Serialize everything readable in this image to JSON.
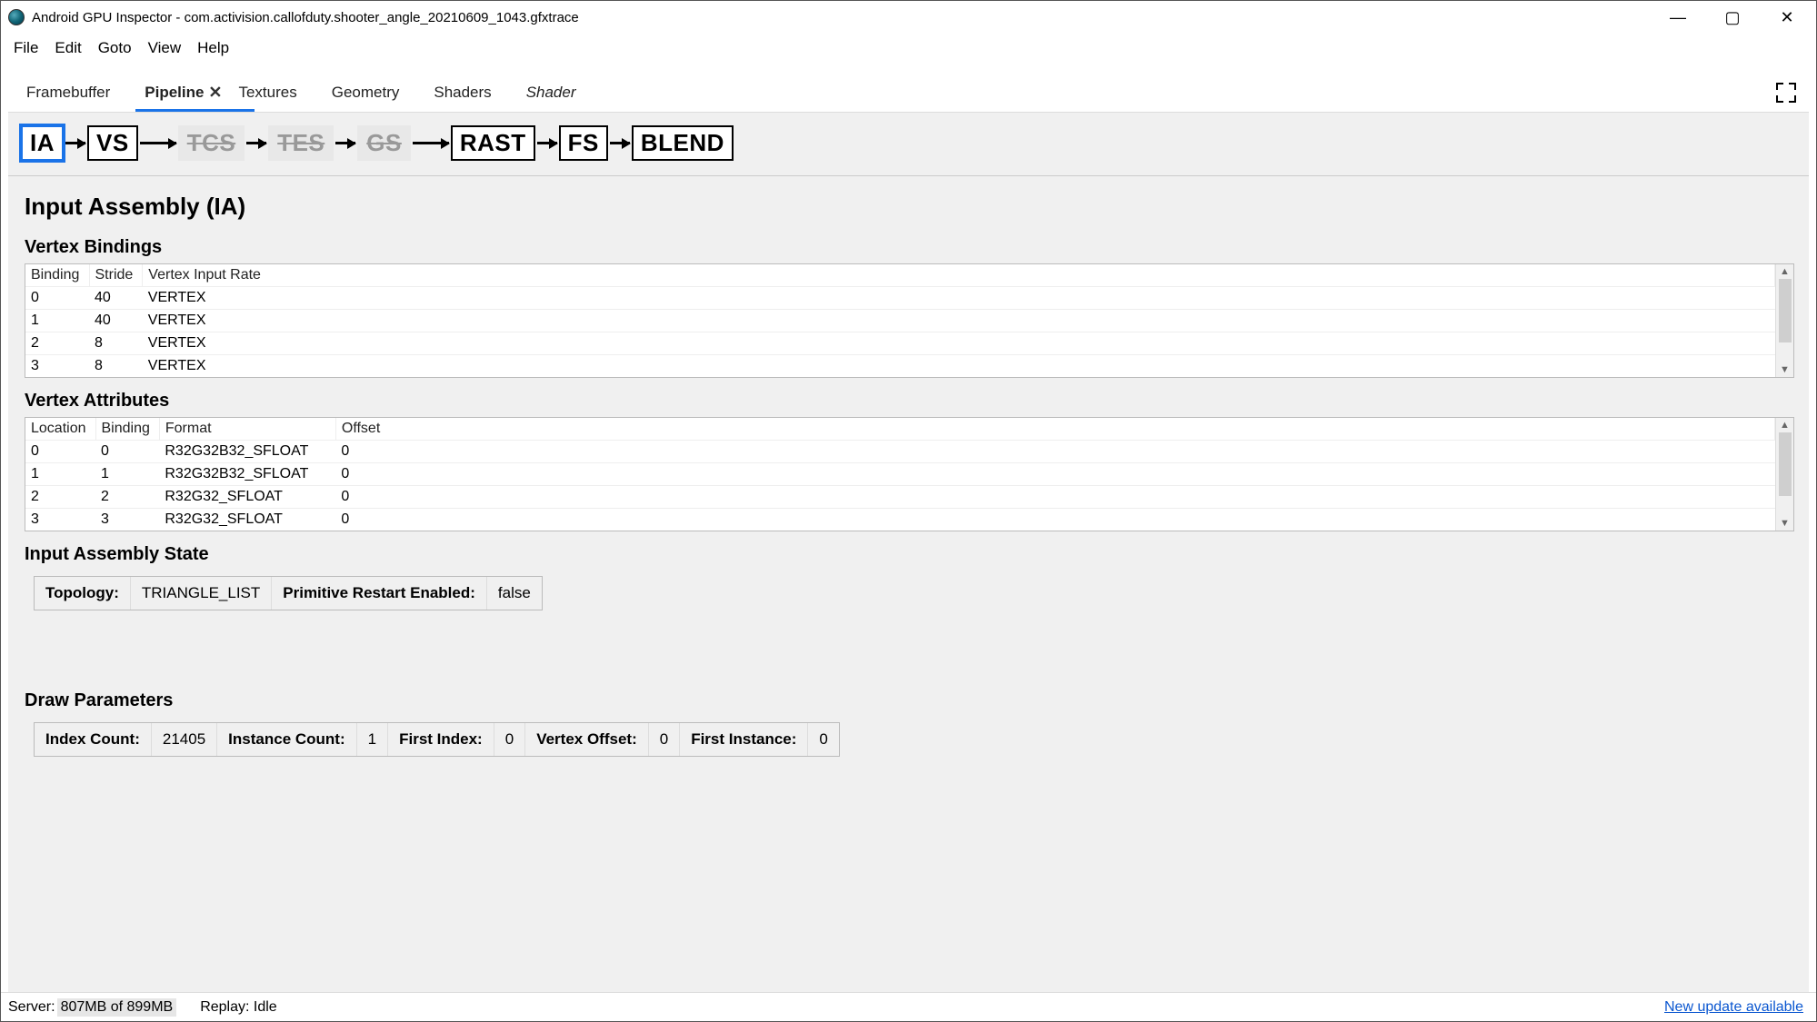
{
  "window": {
    "title": "Android GPU Inspector - com.activision.callofduty.shooter_angle_20210609_1043.gfxtrace"
  },
  "menubar": [
    "File",
    "Edit",
    "Goto",
    "View",
    "Help"
  ],
  "tabs": [
    {
      "label": "Framebuffer",
      "closable": false,
      "active": false,
      "italic": false
    },
    {
      "label": "Pipeline",
      "closable": true,
      "active": true,
      "italic": false
    },
    {
      "label": "Textures",
      "closable": false,
      "active": false,
      "italic": false
    },
    {
      "label": "Geometry",
      "closable": false,
      "active": false,
      "italic": false
    },
    {
      "label": "Shaders",
      "closable": false,
      "active": false,
      "italic": false
    },
    {
      "label": "Shader",
      "closable": false,
      "active": false,
      "italic": true
    }
  ],
  "pipeline_stages": [
    {
      "label": "IA",
      "state": "selected"
    },
    {
      "label": "VS",
      "state": "enabled"
    },
    {
      "label": "TCS",
      "state": "disabled"
    },
    {
      "label": "TES",
      "state": "disabled"
    },
    {
      "label": "GS",
      "state": "disabled"
    },
    {
      "label": "RAST",
      "state": "enabled"
    },
    {
      "label": "FS",
      "state": "enabled"
    },
    {
      "label": "BLEND",
      "state": "enabled"
    }
  ],
  "headings": {
    "main": "Input Assembly (IA)",
    "vb": "Vertex Bindings",
    "va": "Vertex Attributes",
    "ias": "Input Assembly State",
    "dp": "Draw Parameters"
  },
  "vertex_bindings": {
    "columns": [
      "Binding",
      "Stride",
      "Vertex Input Rate"
    ],
    "rows": [
      {
        "binding": "0",
        "stride": "40",
        "rate": "VERTEX"
      },
      {
        "binding": "1",
        "stride": "40",
        "rate": "VERTEX"
      },
      {
        "binding": "2",
        "stride": "8",
        "rate": "VERTEX"
      },
      {
        "binding": "3",
        "stride": "8",
        "rate": "VERTEX"
      }
    ]
  },
  "vertex_attributes": {
    "columns": [
      "Location",
      "Binding",
      "Format",
      "Offset"
    ],
    "rows": [
      {
        "location": "0",
        "binding": "0",
        "format": "R32G32B32_SFLOAT",
        "offset": "0"
      },
      {
        "location": "1",
        "binding": "1",
        "format": "R32G32B32_SFLOAT",
        "offset": "0"
      },
      {
        "location": "2",
        "binding": "2",
        "format": "R32G32_SFLOAT",
        "offset": "0"
      },
      {
        "location": "3",
        "binding": "3",
        "format": "R32G32_SFLOAT",
        "offset": "0"
      }
    ]
  },
  "input_assembly_state": {
    "topology_label": "Topology:",
    "topology_value": "TRIANGLE_LIST",
    "pre_label": "Primitive Restart Enabled:",
    "pre_value": "false"
  },
  "draw_params": {
    "index_count_label": "Index Count:",
    "index_count_value": "21405",
    "instance_count_label": "Instance Count:",
    "instance_count_value": "1",
    "first_index_label": "First Index:",
    "first_index_value": "0",
    "vertex_offset_label": "Vertex Offset:",
    "vertex_offset_value": "0",
    "first_instance_label": "First Instance:",
    "first_instance_value": "0"
  },
  "status": {
    "server_label": "Server:",
    "server_value": "807MB of 899MB",
    "replay_label": "Replay:",
    "replay_value": "Idle",
    "update_link": "New update available"
  }
}
